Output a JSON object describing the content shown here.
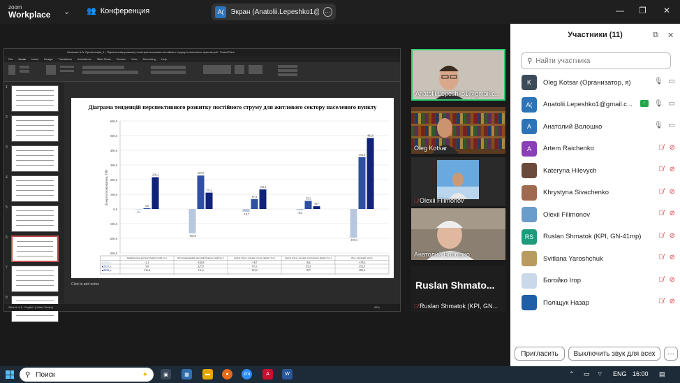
{
  "topbar": {
    "logo_line1": "zoom",
    "logo_line2": "Workplace",
    "conference_label": "Конференция",
    "share_avatar": "A(",
    "share_label": "Экран (Anatolii.Lepeshko1@gmail.com)"
  },
  "ppt": {
    "title": "Лепешко А.А. Презентація_1 - Перспективи розвитку електропостачання постійного струму в населених пунктах.pdf - PowerPoint",
    "search": "Search",
    "tabs": [
      "File",
      "Home",
      "Insert",
      "Design",
      "Transitions",
      "Animations",
      "Slide Show",
      "Review",
      "View",
      "Recording",
      "Help"
    ],
    "ribbon_groups": [
      "Clipboard",
      "Slides",
      "Font",
      "Paragraph",
      "Drawing",
      "Editing"
    ],
    "thumb_numbers": [
      "1",
      "2",
      "3",
      "4",
      "5",
      "6",
      "7",
      "8"
    ],
    "notes": "Click to add notes",
    "status_left": "Slide 6 of 8",
    "status_lang": "English (United States)",
    "status_zoom": "55%"
  },
  "chart_data": {
    "type": "bar",
    "title": "Діаграма тенденцій перспективного розвитку постійного струму для житлового сектору населеного пункту",
    "ylabel": "Енергоспоживання, ГВт",
    "ylim": [
      -300,
      600
    ],
    "yticks": [
      "600,0",
      "500,0",
      "400,0",
      "300,0",
      "200,0",
      "100,0",
      "0,0",
      "-100,0",
      "-200,0",
      "-300,0"
    ],
    "categories": [
      "Індивідуальне житлове будівля (cкий 3ос.)",
      "Багатоквартирний житловий будинок (cкий 3ос.)",
      "Заклад тімчас. прожив. готель (кімнат 3ос.)",
      "Заклад тімчас. прожив. (гуртожиток (кімнат 3ос.)",
      "Весь житловий сектор"
    ],
    "series": [
      {
        "name": "1990 р.",
        "values": [
          -2.1,
          -165.8,
          -18.7,
          -8.4,
          -195.3
        ],
        "labels": [
          "-2,1",
          "-165,8",
          "-18,7",
          "-8,4",
          "-195,3"
        ]
      },
      {
        "name": "2025 р.",
        "values": [
          5.8,
          227.9,
          67.3,
          55.3,
          352.8
        ],
        "labels": [
          "5,8",
          "227,9",
          "67,3",
          "55,3",
          "352,8"
        ]
      },
      {
        "name": "2050 р.",
        "values": [
          216.4,
          111.2,
          133.2,
          18.7,
          483.6
        ],
        "labels": [
          "216,4",
          "111,2",
          "133,2",
          "18,7",
          "483,6"
        ]
      }
    ],
    "colors": [
      "#b8c7e0",
      "#2f4fa3",
      "#10227a"
    ],
    "table_rows": [
      [
        "■1990 р.",
        "-2,1",
        "-165,8",
        "-18,7",
        "-8,4",
        "-195,3"
      ],
      [
        "■2025 р.",
        "5,8",
        "227,9",
        "67,3",
        "55,3",
        "352,8"
      ],
      [
        "■2050 р.",
        "216,4",
        "111,2",
        "133,2",
        "18,7",
        "483,6"
      ]
    ]
  },
  "gallery": [
    {
      "name": "Anatolii.Lepeshko1@gmail.c...",
      "muted": false
    },
    {
      "name": "Oleg Kotsar",
      "muted": false
    },
    {
      "name": "Olexii Filimonov",
      "muted": true
    },
    {
      "name": "Анатолий Волошко",
      "muted": false
    },
    {
      "name": "Ruslan Shmatok (KPI, GN...",
      "muted": true,
      "big_text": "Ruslan  Shmato..."
    }
  ],
  "panel": {
    "title": "Участники (11)",
    "search_placeholder": "Найти участника",
    "participants": [
      {
        "initials": "K",
        "name": "Oleg Kotsar (Организатор, я)",
        "color": "#3c4b5a",
        "mic": "on",
        "video": "on"
      },
      {
        "initials": "A(",
        "name": "Anatolii.Lepeshko1@gmail.c...",
        "color": "#2d73b7",
        "mic": "on",
        "video": "on",
        "sharing": true
      },
      {
        "initials": "A",
        "name": "Анатолий Волошко",
        "color": "#2d73b7",
        "mic": "on",
        "video": "on"
      },
      {
        "initials": "A",
        "name": "Artem Raichenko",
        "color": "#8a3fb7",
        "mic": "off",
        "video": "off"
      },
      {
        "initials": "",
        "name": "Kateryna Hilevych",
        "color": "#6b4a3a",
        "mic": "off",
        "video": "off"
      },
      {
        "initials": "",
        "name": "Khrystyna Sivachenko",
        "color": "#a06a50",
        "mic": "off",
        "video": "off"
      },
      {
        "initials": "",
        "name": "Olexii Filimonov",
        "color": "#6a9ccc",
        "mic": "off",
        "video": "off"
      },
      {
        "initials": "RS",
        "name": "Ruslan Shmatok (KPI, GN-41mp)",
        "color": "#1d9b7a",
        "mic": "off",
        "video": "off"
      },
      {
        "initials": "",
        "name": "Svitlana Yaroshchuk",
        "color": "#b99a60",
        "mic": "off",
        "video": "off"
      },
      {
        "initials": "",
        "name": "Богойко Ігор",
        "color": "#c9d9ea",
        "mic": "off",
        "video": "off"
      },
      {
        "initials": "",
        "name": "Поліщук Назар",
        "color": "#1f5fa8",
        "mic": "off",
        "video": "off"
      }
    ],
    "invite_button": "Пригласить",
    "mute_all_button": "Выключить звук для всех"
  },
  "taskbar": {
    "search": "Поиск",
    "lang": "ENG",
    "time": "16:00"
  }
}
